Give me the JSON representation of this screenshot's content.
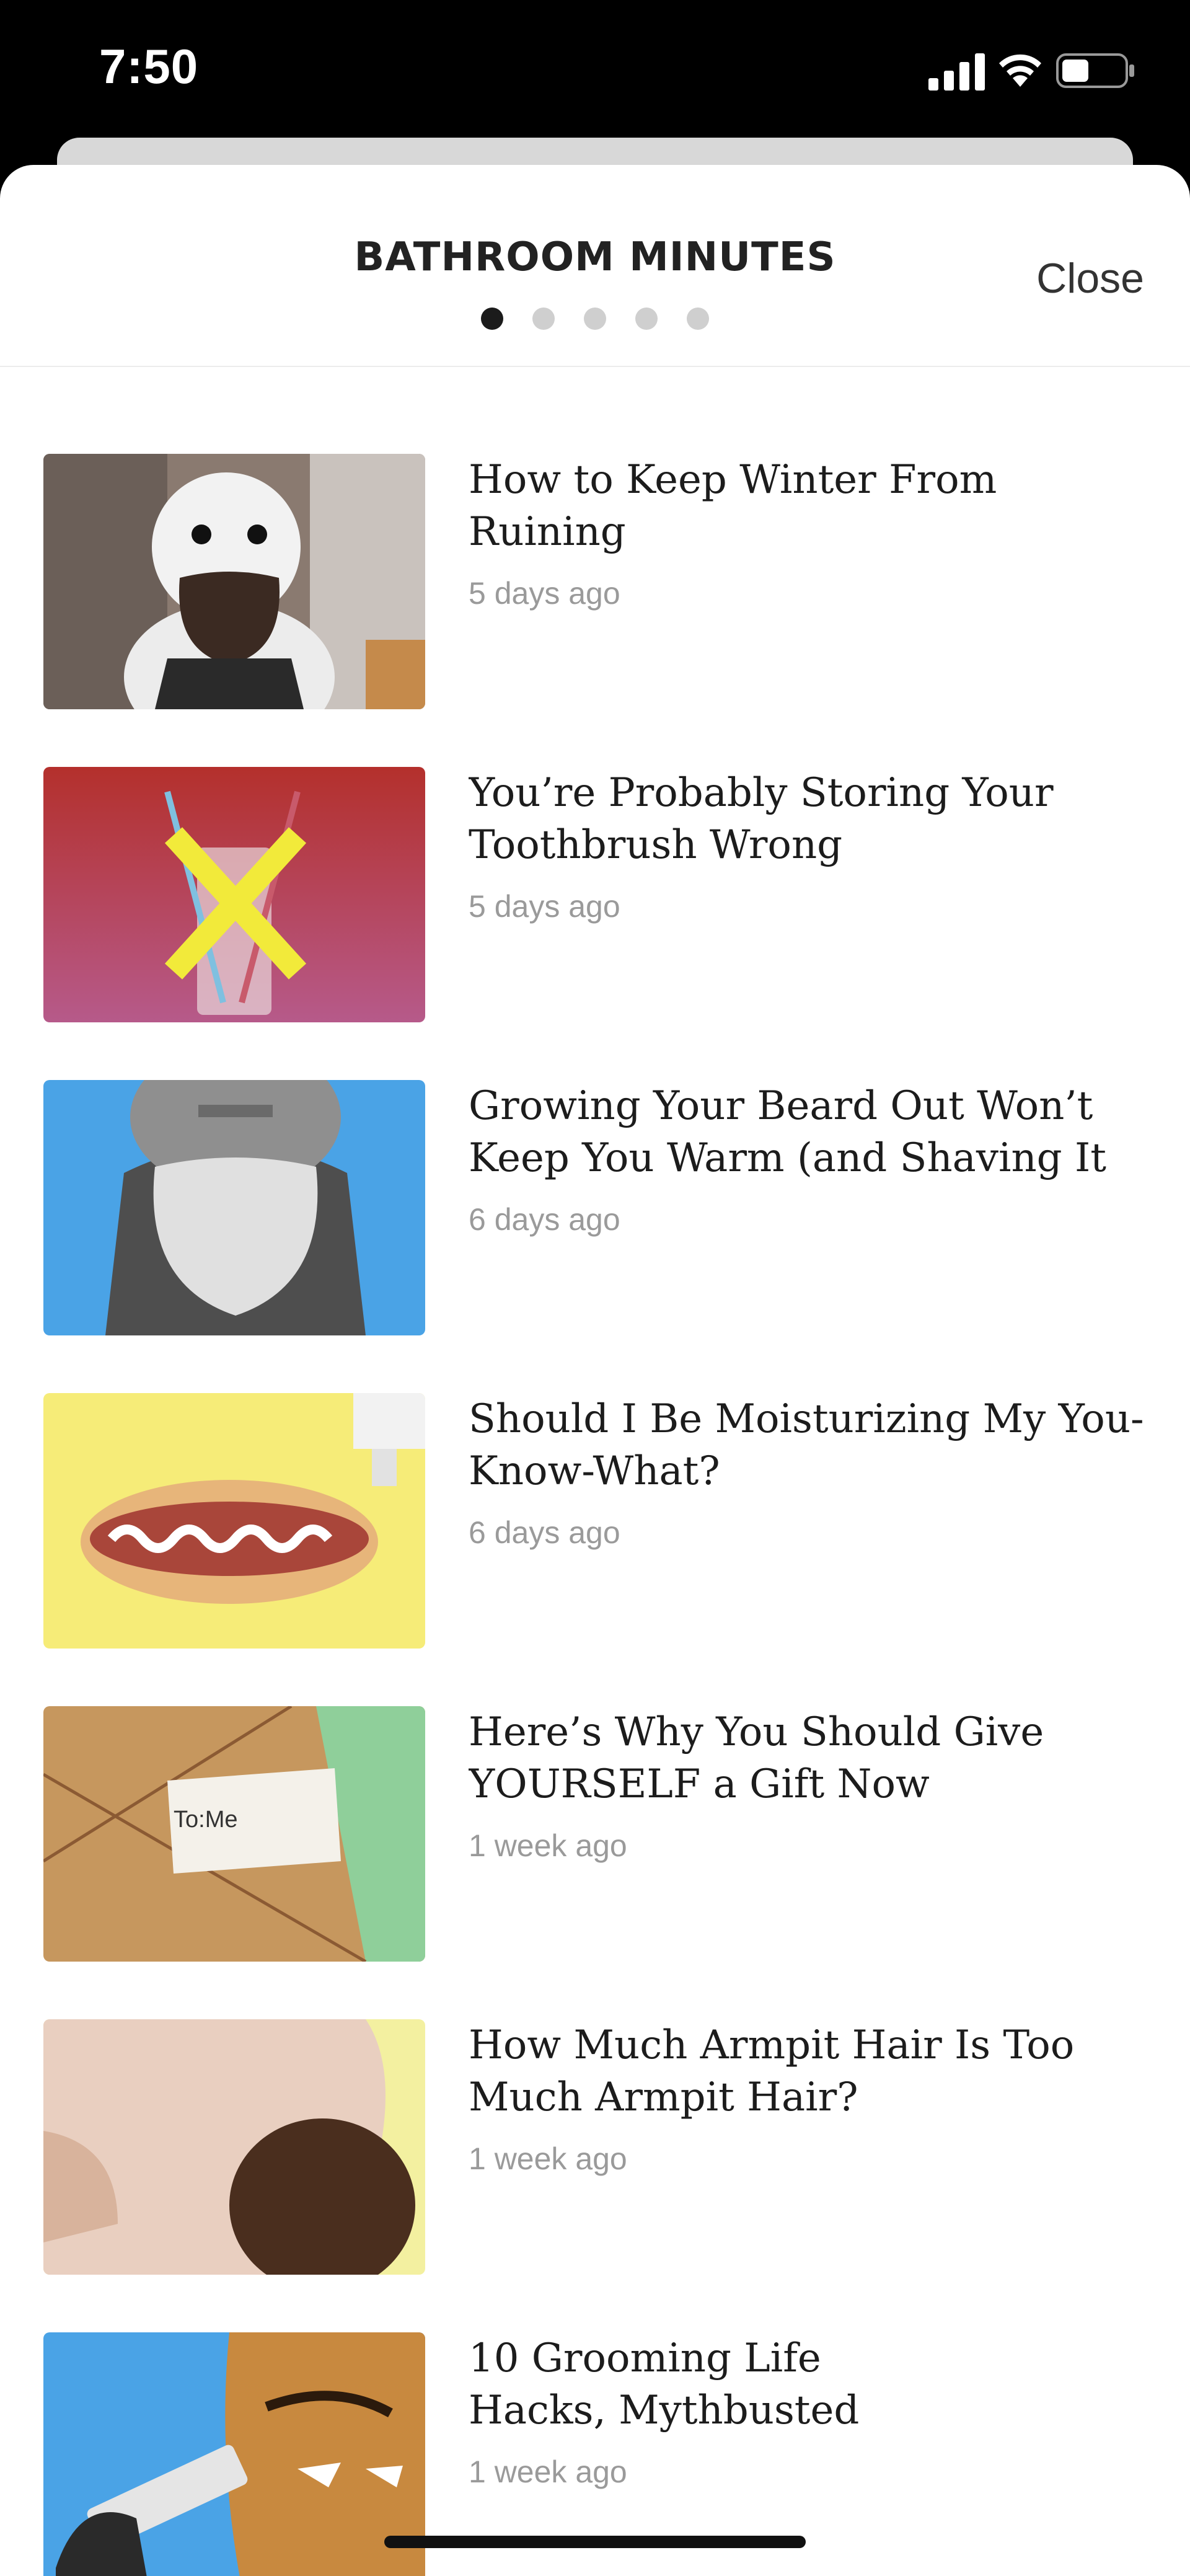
{
  "status_bar": {
    "time": "7:50",
    "icons": [
      "signal-icon",
      "wifi-icon",
      "battery-icon"
    ]
  },
  "header": {
    "title": "BATHROOM MINUTES",
    "close_label": "Close",
    "page_count": 5,
    "active_page": 1
  },
  "articles": [
    {
      "title": "How to Keep Winter From Ruining\nYour Beard",
      "time": "5 days ago",
      "thumb": "snowman-beard"
    },
    {
      "title": "You’re Probably Storing Your\nToothbrush Wrong",
      "time": "5 days ago",
      "thumb": "toothbrush-cup"
    },
    {
      "title": "Growing Your Beard Out Won’t\nKeep You Warm (and Shaving It o...",
      "time": "6 days ago",
      "thumb": "bearded-man"
    },
    {
      "title": "Should I Be Moisturizing My You-\nKnow-What?",
      "time": "6 days ago",
      "thumb": "hotdog-lotion"
    },
    {
      "title": "Here’s Why You Should Give\nYOURSELF a Gift Now",
      "time": "1 week ago",
      "thumb": "gift-package",
      "thumb_label": "To:Me"
    },
    {
      "title": "How Much Armpit Hair Is Too\nMuch Armpit Hair?",
      "time": "1 week ago",
      "thumb": "armpit-hair"
    },
    {
      "title": "10 Grooming Life\nHacks, Mythbusted",
      "time": "1 week ago",
      "thumb": "man-tube"
    }
  ],
  "colors": {
    "background": "#ffffff",
    "status_bar": "#000000",
    "title_text": "#1c1c1c",
    "meta_text": "#9a9a9a",
    "active_dot": "#1b1b1b",
    "inactive_dot": "#cfcfcf"
  }
}
